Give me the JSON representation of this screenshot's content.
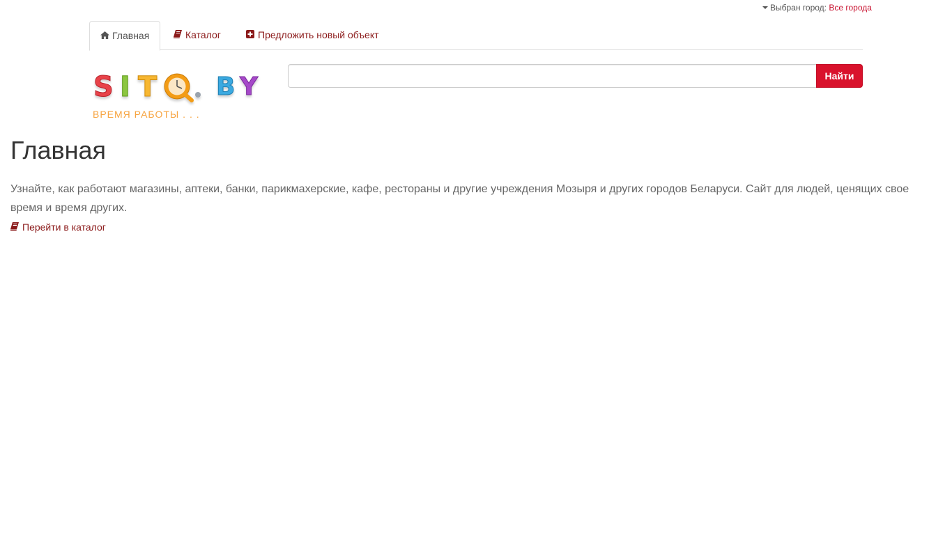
{
  "city_selector": {
    "label": "Выбран город:",
    "value": "Все города"
  },
  "tabs": [
    {
      "label": "Главная",
      "icon": "home-icon",
      "active": true
    },
    {
      "label": "Каталог",
      "icon": "book-icon",
      "active": false
    },
    {
      "label": "Предложить новый объект",
      "icon": "plus-square-icon",
      "active": false
    }
  ],
  "logo": {
    "brand": "SITQ.BY",
    "tagline": "ВРЕМЯ РАБОТЫ . . ."
  },
  "search": {
    "value": "",
    "placeholder": "",
    "button_label": "Найти"
  },
  "main": {
    "title": "Главная",
    "intro": "Узнайте, как работают магазины, аптеки, банки, парикмахерские, кафе, рестораны и другие учреждения Мозыря и других городов Беларуси. Сайт для людей, ценящих свое время и время других.",
    "catalog_link": "Перейти в каталог"
  },
  "colors": {
    "accent": "#d9122c",
    "link": "#8b1a1a",
    "city_link": "#c8102e"
  }
}
